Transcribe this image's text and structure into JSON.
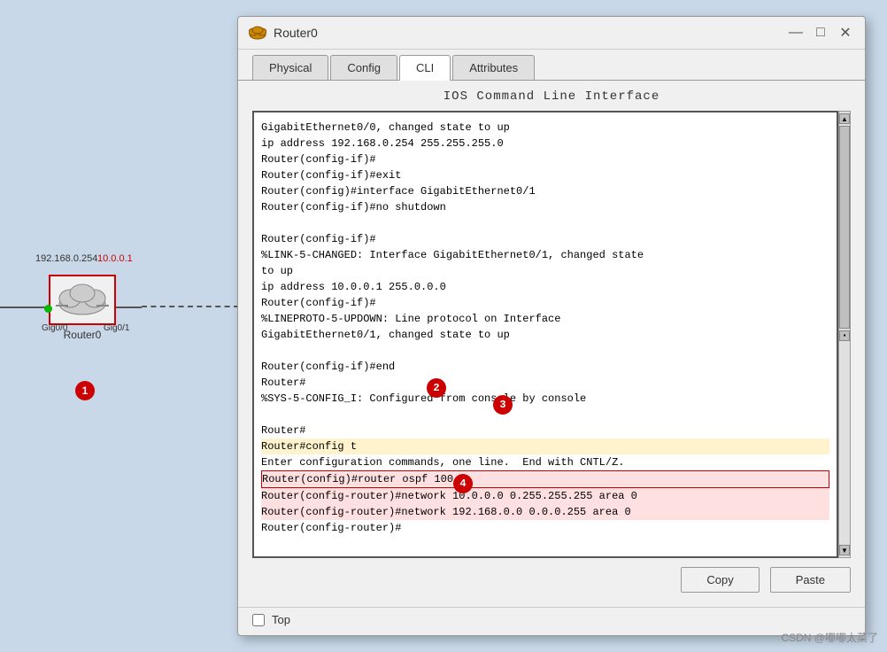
{
  "window": {
    "title": "Router0",
    "tabs": [
      "Physical",
      "Config",
      "CLI",
      "Attributes"
    ],
    "active_tab": "CLI"
  },
  "cli": {
    "heading": "IOS Command Line Interface",
    "terminal_content": [
      "GigabitEthernet0/0, changed state to up",
      "ip address 192.168.0.254 255.255.255.0",
      "Router(config-if)#",
      "Router(config-if)#exit",
      "Router(config)#interface GigabitEthernet0/1",
      "Router(config-if)#no shutdown",
      "",
      "Router(config-if)#",
      "%LINK-5-CHANGED: Interface GigabitEthernet0/1, changed state",
      "to up",
      "ip address 10.0.0.1 255.0.0.0",
      "Router(config-if)#",
      "%LINEPROTO-5-UPDOWN: Line protocol on Interface",
      "GigabitEthernet0/1, changed state to up",
      "",
      "Router(config-if)#end",
      "Router#",
      "%SYS-5-CONFIG_I: Configured from console by console",
      "",
      "Router#",
      "Router#config t",
      "Enter configuration commands, one line.  End with CNTL/Z.",
      "Router(config)#router ospf 100",
      "Router(config-router)#network 10.0.0.0 0.255.255.255 area 0",
      "Router(config-router)#network 192.168.0.0 0.0.0.255 area 0",
      "Router(config-router)#"
    ],
    "highlighted_lines": {
      "cmd_line": "Router#config t",
      "config_line": "Router(config)#router ospf 100",
      "network_lines": [
        "Router(config-router)#network 10.0.0.0 0.255.255.255 area 0",
        "Router(config-router)#network 192.168.0.0 0.0.0.255 area 0"
      ]
    },
    "copy_button": "Copy",
    "paste_button": "Paste"
  },
  "network": {
    "router_name": "Router0",
    "ip_left": "192.168.0.254",
    "ip_right": "10.0.0.1",
    "port_left": "Gig0/0",
    "port_right": "Gig0/1"
  },
  "steps": {
    "s1": "1",
    "s2": "2",
    "s3": "3",
    "s4": "4"
  },
  "bottom": {
    "checkbox_label": "Top"
  },
  "watermark": "CSDN @嘟嘟太菜了",
  "title_controls": {
    "minimize": "—",
    "maximize": "□",
    "close": "✕"
  }
}
